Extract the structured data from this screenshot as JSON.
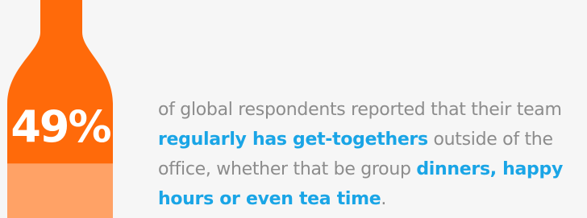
{
  "stat": {
    "value": "49%",
    "fill_fraction": 0.25
  },
  "statement": {
    "part1": "of global respondents reported that their team ",
    "highlight1": "regularly has get-togethers",
    "part2": " outside of the office, whether that be group ",
    "highlight2": "dinners, happy hours or even tea time",
    "part3": "."
  },
  "colors": {
    "bottle": "#ff6a0a",
    "bottle_fill": "#ffa266",
    "highlight": "#1aa5e6",
    "body_text": "#8c8c8c",
    "background": "#f6f6f6"
  }
}
